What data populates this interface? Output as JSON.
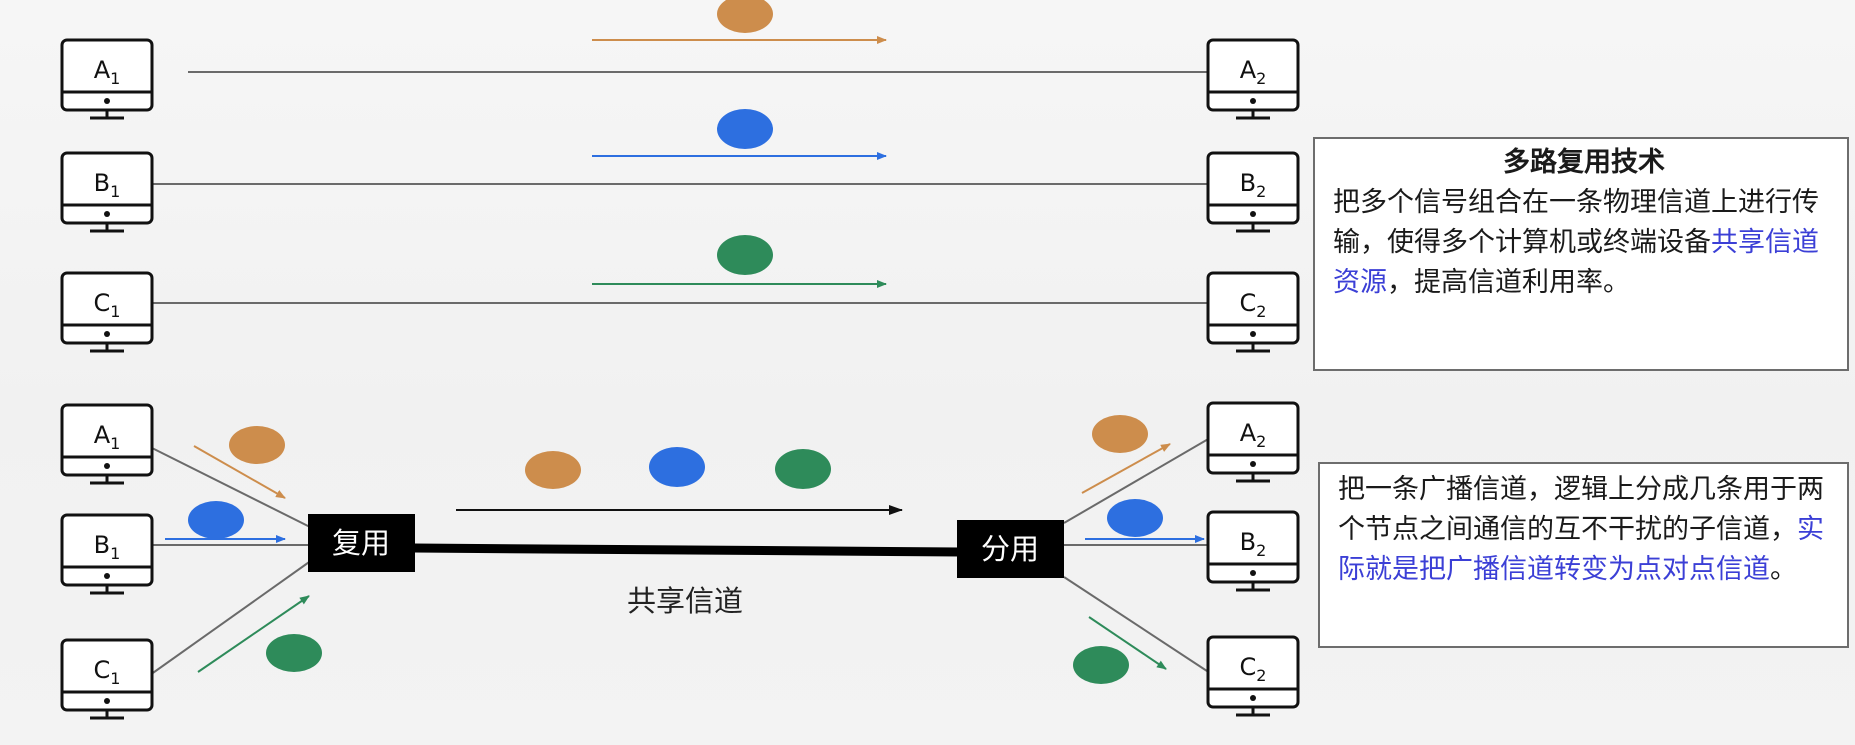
{
  "colors": {
    "orange": "#cd8d4c",
    "blue": "#2d6fe0",
    "green": "#2e8b5a",
    "line": "#6a6a6a",
    "box": "#000000",
    "highlight": "#3b3fd6"
  },
  "computers": {
    "top_left": [
      {
        "letter": "A",
        "sub": "1"
      },
      {
        "letter": "B",
        "sub": "1"
      },
      {
        "letter": "C",
        "sub": "1"
      }
    ],
    "top_right": [
      {
        "letter": "A",
        "sub": "2"
      },
      {
        "letter": "B",
        "sub": "2"
      },
      {
        "letter": "C",
        "sub": "2"
      }
    ],
    "bottom_left": [
      {
        "letter": "A",
        "sub": "1"
      },
      {
        "letter": "B",
        "sub": "1"
      },
      {
        "letter": "C",
        "sub": "1"
      }
    ],
    "bottom_right": [
      {
        "letter": "A",
        "sub": "2"
      },
      {
        "letter": "B",
        "sub": "2"
      },
      {
        "letter": "C",
        "sub": "2"
      }
    ]
  },
  "mux_label": "复用",
  "demux_label": "分用",
  "shared_channel_label": "共享信道",
  "multiplexing_box": {
    "title": "多路复用技术",
    "text_before": "把多个信号组合在一条物理信道上进行传输，使得多个计算机或终端设备",
    "highlight": "共享信道资源",
    "text_after": "，提高信道利用率。"
  },
  "broadcast_box": {
    "text_before": "把一条广播信道，逻辑上分成几条用于两个节点之间通信的互不干扰的子信道，",
    "highlight": "实际就是把广播信道转变为点对点信道",
    "text_after": "。"
  }
}
